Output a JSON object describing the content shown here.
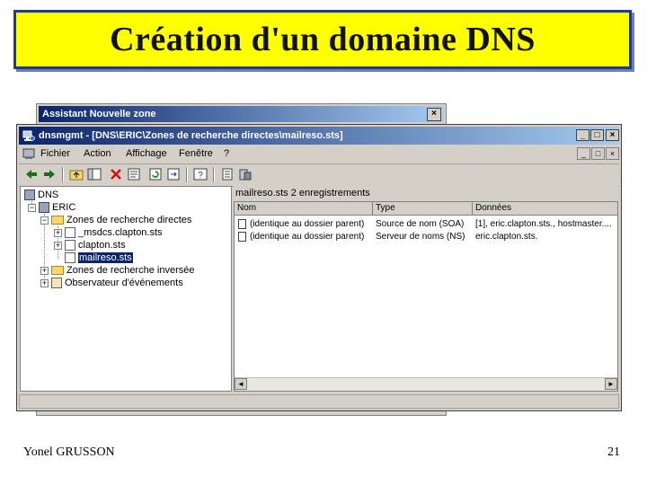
{
  "slide": {
    "title": "Création d'un domaine DNS",
    "author": "Yonel GRUSSON",
    "page_number": "21"
  },
  "wizard": {
    "title": "Assistant Nouvelle zone",
    "close_label": "×"
  },
  "window": {
    "title": "dnsmgmt - [DNS\\ERIC\\Zones de recherche directes\\mailreso.sts]",
    "minimize_label": "_",
    "maximize_label": "□",
    "close_label": "×",
    "icon": "dns-app-icon"
  },
  "menu": {
    "items": [
      "Fichier",
      "Action",
      "Affichage",
      "Fenêtre",
      "?"
    ],
    "minimize_label": "_",
    "restore_label": "□",
    "close_label": "×"
  },
  "toolbar": {
    "icons": [
      "back-icon",
      "forward-icon",
      "up-folder-icon",
      "show-tree-icon",
      "delete-icon",
      "properties-icon",
      "refresh-icon",
      "export-icon",
      "help-icon",
      "new-record-icon",
      "new-domain-icon"
    ]
  },
  "tree": {
    "root": "DNS",
    "server": "ERIC",
    "forward_zones": "Zones de recherche directes",
    "zones": [
      "_msdcs.clapton.sts",
      "clapton.sts",
      "mailreso.sts"
    ],
    "reverse_zones": "Zones de recherche inversée",
    "event_viewer": "Observateur d'événements",
    "expand_symbol": "+",
    "collapse_symbol": "−"
  },
  "right_pane": {
    "header": "mailreso.sts   2 enregistrements",
    "columns": [
      "Nom",
      "Type",
      "Données"
    ],
    "rows": [
      {
        "name": "(identique au dossier parent)",
        "type": "Source de nom (SOA)",
        "data": "[1], eric.clapton.sts., hostmaster...."
      },
      {
        "name": "(identique au dossier parent)",
        "type": "Serveur de noms (NS)",
        "data": "eric.clapton.sts."
      }
    ],
    "scroll_left": "◄",
    "scroll_right": "►"
  },
  "colors": {
    "banner": "#ffff00",
    "banner_border": "#1f3a93",
    "titlebar": "#0a246a",
    "selection": "#0a246a"
  }
}
